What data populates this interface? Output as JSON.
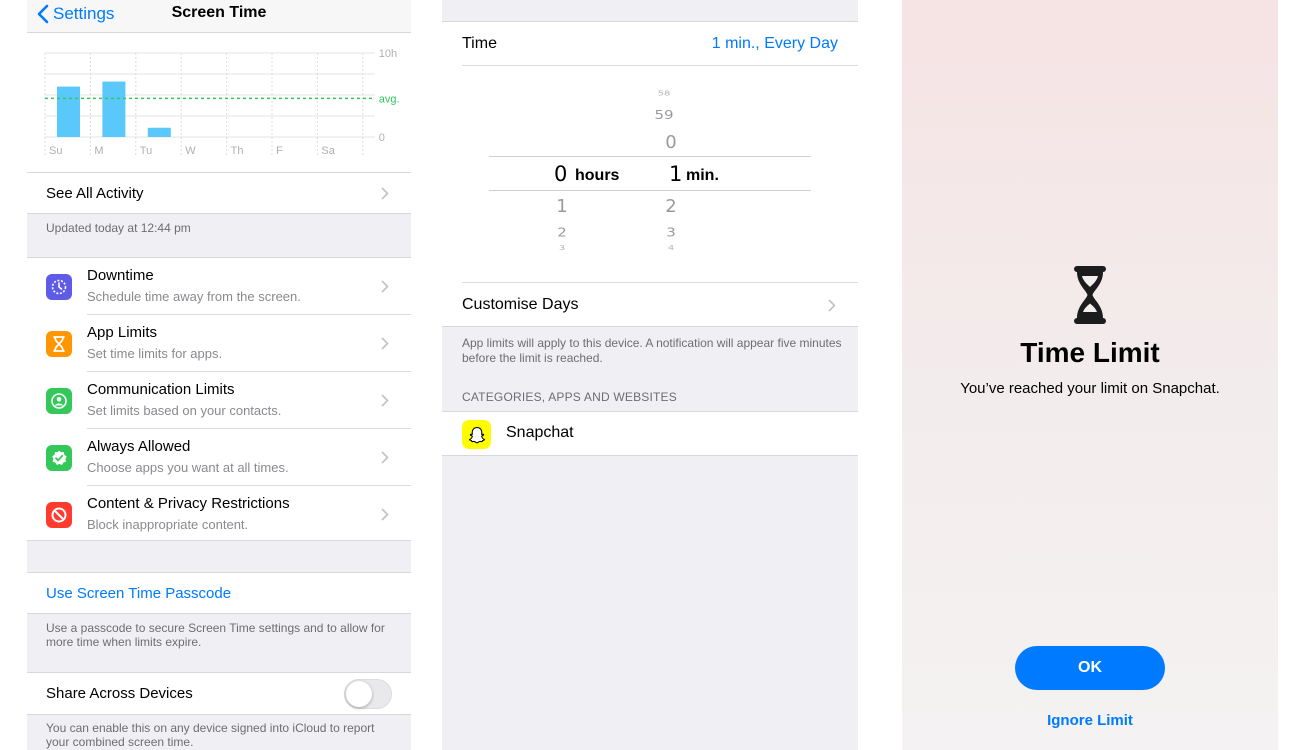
{
  "screen_time": {
    "nav": {
      "back_label": "Settings",
      "title": "Screen Time"
    },
    "chart": {
      "day_labels": [
        "Su",
        "M",
        "Tu",
        "W",
        "Th",
        "F",
        "Sa"
      ],
      "top_label": "10h",
      "avg_label": "avg.",
      "zero_label": "0",
      "usage_hours": [
        6.0,
        6.6,
        1.1,
        0,
        0,
        0,
        0
      ],
      "average_hours": 4.6,
      "max_hours": 10,
      "bar_color": "#5ac8fa",
      "avg_color": "#34c759"
    },
    "see_all_activity": "See All Activity",
    "updated_note": "Updated today at 12:44 pm",
    "items": [
      {
        "title": "Downtime",
        "subtitle": "Schedule time away from the screen.",
        "icon": "downtime-icon",
        "color": "#5e5ce6"
      },
      {
        "title": "App Limits",
        "subtitle": "Set time limits for apps.",
        "icon": "hourglass-icon",
        "color": "#ff9500"
      },
      {
        "title": "Communication Limits",
        "subtitle": "Set limits based on your contacts.",
        "icon": "person-icon",
        "color": "#34c759"
      },
      {
        "title": "Always Allowed",
        "subtitle": "Choose apps you want at all times.",
        "icon": "checkmark-icon",
        "color": "#34c759"
      },
      {
        "title": "Content & Privacy Restrictions",
        "subtitle": "Block inappropriate content.",
        "icon": "restriction-icon",
        "color": "#ff3b30"
      }
    ],
    "passcode_link": "Use Screen Time Passcode",
    "passcode_note": "Use a passcode to secure Screen Time settings and to allow for more time when limits expire.",
    "share_label": "Share Across Devices",
    "share_enabled": false,
    "share_note": "You can enable this on any device signed into iCloud to report your combined screen time."
  },
  "limit_setup": {
    "time_label": "Time",
    "time_value": "1 min., Every Day",
    "picker": {
      "hours_unit": "hours",
      "minutes_unit": "min.",
      "selected_hours": "0",
      "selected_minutes": "1",
      "hours_below": [
        "1",
        "2",
        "3"
      ],
      "minutes_above": [
        "58",
        "59",
        "0"
      ],
      "minutes_below": [
        "2",
        "3",
        "4"
      ]
    },
    "customise_days": "Customise Days",
    "note": "App limits will apply to this device. A notification will appear five minutes before the limit is reached.",
    "section_header": "CATEGORIES, APPS AND WEBSITES",
    "app_name": "Snapchat",
    "app_icon_color": "#fffc00"
  },
  "time_limit": {
    "icon": "hourglass-icon",
    "title": "Time Limit",
    "message": "You’ve reached your limit on Snapchat.",
    "ok_label": "OK",
    "ignore_label": "Ignore Limit"
  }
}
